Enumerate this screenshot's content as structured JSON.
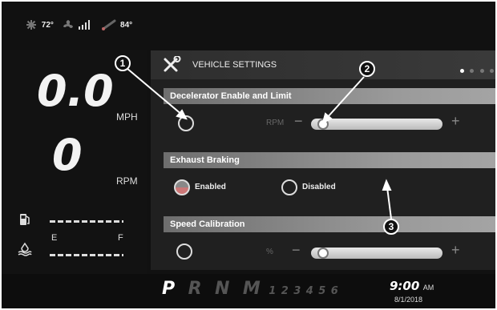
{
  "status": {
    "fan_temp": "72°",
    "outside_temp": "84°"
  },
  "left": {
    "speed_value": "0.0",
    "speed_unit": "MPH",
    "rpm_value": "0",
    "rpm_unit": "RPM",
    "fuel_empty": "E",
    "fuel_full": "F"
  },
  "panel": {
    "title": "VEHICLE SETTINGS",
    "sections": {
      "decelerator": {
        "label": "Decelerator Enable and Limit",
        "unit": "RPM",
        "minus": "−",
        "plus": "+"
      },
      "exhaust": {
        "label": "Exhaust Braking",
        "option_enabled": "Enabled",
        "option_disabled": "Disabled"
      },
      "speed_cal": {
        "label": "Speed Calibration",
        "unit": "%",
        "minus": "−",
        "plus": "+"
      }
    }
  },
  "callouts": [
    "1",
    "2",
    "3"
  ],
  "bottom": {
    "gears": [
      "P",
      "R",
      "N",
      "M",
      "1",
      "2",
      "3",
      "4",
      "5",
      "6"
    ],
    "time": "9:00",
    "ampm": "AM",
    "date": "8/1/2018"
  }
}
